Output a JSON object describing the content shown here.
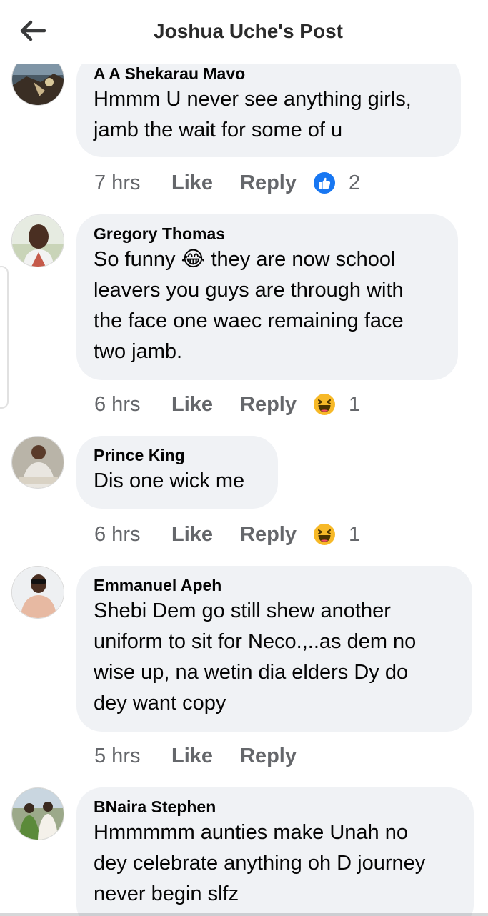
{
  "header": {
    "title": "Joshua Uche's Post",
    "back_icon": "back-arrow-icon"
  },
  "comments": [
    {
      "author": "A A Shekarau Mavo",
      "lines": [
        "Hmmm U never see anything girls,",
        "jamb the wait for some of u"
      ],
      "time": "7 hrs",
      "like_label": "Like",
      "reply_label": "Reply",
      "reaction_icon": "like-reaction-icon",
      "reaction_count": "2"
    },
    {
      "author": "Gregory Thomas",
      "lines": [
        "So funny 😂 they are now school",
        "leavers you guys are through with",
        "the face one waec remaining face",
        "two jamb."
      ],
      "time": "6 hrs",
      "like_label": "Like",
      "reply_label": "Reply",
      "reaction_icon": "haha-reaction-icon",
      "reaction_count": "1"
    },
    {
      "author": "Prince King",
      "lines": [
        "Dis one wick me"
      ],
      "time": "6 hrs",
      "like_label": "Like",
      "reply_label": "Reply",
      "reaction_icon": "haha-reaction-icon",
      "reaction_count": "1"
    },
    {
      "author": "Emmanuel Apeh",
      "lines": [
        "Shebi Dem go still shew another",
        "uniform to sit for Neco.,..as dem no",
        "wise up, na wetin dia elders Dy do",
        "dey want copy"
      ],
      "time": "5 hrs",
      "like_label": "Like",
      "reply_label": "Reply"
    },
    {
      "author": "BNaira Stephen",
      "lines": [
        "Hmmmmm aunties make Unah no",
        "dey celebrate anything oh D journey",
        "never begin slfz"
      ]
    }
  ],
  "colors": {
    "bubble": "#f0f2f5",
    "meta_text": "#65676b",
    "like_blue": "#1877f2",
    "haha_yellow": "#f7b928"
  }
}
